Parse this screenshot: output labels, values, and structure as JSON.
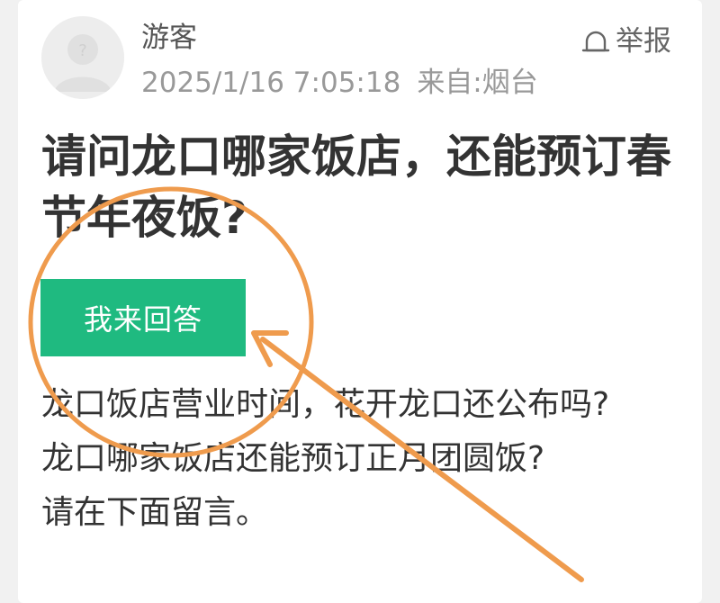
{
  "post": {
    "author": "游客",
    "timestamp": "2025/1/16 7:05:18",
    "source_label": "来自:",
    "source_location": "烟台",
    "report_label": "举报",
    "title": "请问龙口哪家饭店，还能预订春节年夜饭?",
    "answer_button_label": "我来回答",
    "body": {
      "line1": "龙口饭店营业时间，花开龙口还公布吗?",
      "line2": "龙口哪家饭店还能预订正月团圆饭?",
      "line3": "请在下面留言。"
    }
  },
  "icons": {
    "avatar": "user-avatar-placeholder-icon",
    "report": "bell-report-icon"
  },
  "colors": {
    "accent_green": "#1fba80",
    "annotation_orange": "#ef9b4d",
    "title_text": "#333333",
    "meta_text": "#999999"
  }
}
